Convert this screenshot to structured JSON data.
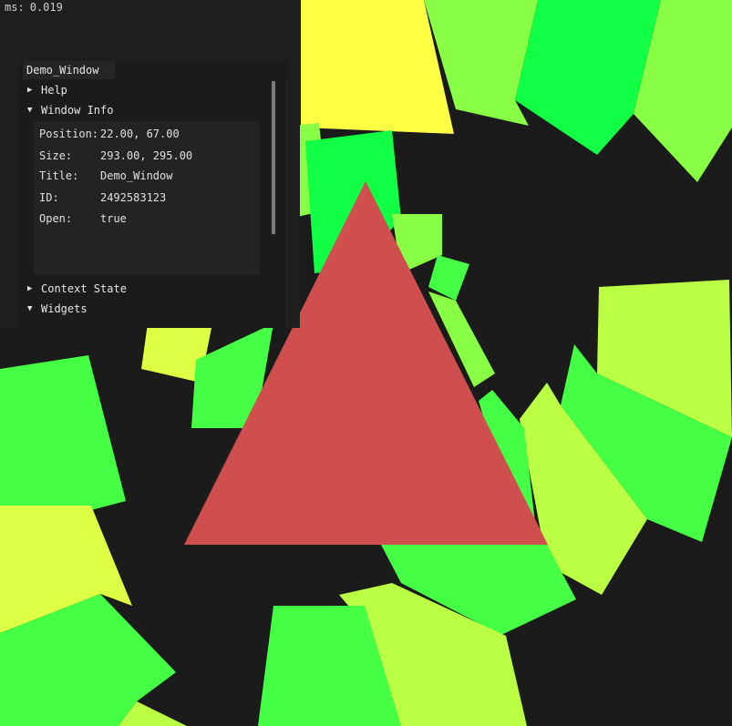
{
  "stats": {
    "ms_label": "ms:",
    "ms_value": "0.019"
  },
  "demo_window": {
    "title": "Demo_Window",
    "tree": {
      "help": "Help",
      "window_info": "Window Info",
      "context_state": "Context State",
      "widgets": "Widgets"
    },
    "info": [
      {
        "label": "Position:",
        "value": "22.00, 67.00"
      },
      {
        "label": "Size:",
        "value": "293.00, 295.00"
      },
      {
        "label": "Title:",
        "value": "Demo_Window"
      },
      {
        "label": "ID:",
        "value": "2492583123"
      },
      {
        "label": "Open:",
        "value": "true"
      }
    ]
  },
  "icons": {
    "collapsed": "arrow-right-icon",
    "expanded": "arrow-down-icon"
  },
  "colors": {
    "background": "#1b1b1b",
    "triangle": "#cf4e4e",
    "quad_palette": [
      "#ffff44",
      "#88ff44",
      "#11ff44",
      "#bbff44",
      "#44ff44"
    ]
  }
}
